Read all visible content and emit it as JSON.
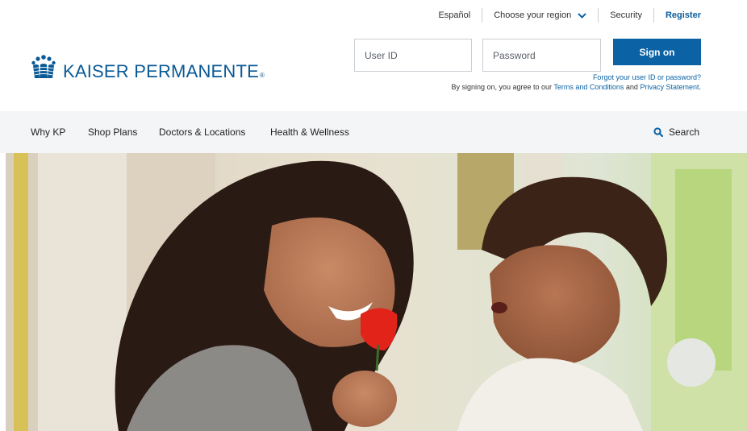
{
  "utility": {
    "espanol": "Español",
    "region": "Choose your region",
    "security": "Security",
    "register": "Register"
  },
  "brand": {
    "name": "KAISER PERMANENTE",
    "reg": "®",
    "color": "#0a5a96"
  },
  "signin": {
    "userid_placeholder": "User ID",
    "password_placeholder": "Password",
    "button_label": "Sign on",
    "forgot": "Forgot your user ID or password?",
    "agree_prefix": "By signing on, you agree to our ",
    "terms": "Terms and Conditions",
    "agree_and": " and ",
    "privacy": "Privacy Statement",
    "agree_suffix": "."
  },
  "nav": {
    "items": [
      "Why KP",
      "Shop Plans",
      "Doctors & Locations",
      "Health & Wellness"
    ],
    "search": "Search"
  },
  "colors": {
    "accent": "#0b62a4",
    "nav_bg": "#f3f5f7"
  }
}
